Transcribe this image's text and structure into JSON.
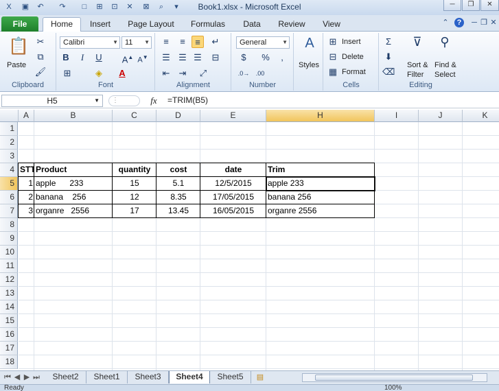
{
  "window": {
    "title": "Book1.xlsx  -  Microsoft Excel"
  },
  "ribbon_tabs": [
    "File",
    "Home",
    "Insert",
    "Page Layout",
    "Formulas",
    "Data",
    "Review",
    "View"
  ],
  "active_tab": "Home",
  "ribbon": {
    "clipboard": {
      "label": "Clipboard",
      "paste": "Paste"
    },
    "font": {
      "label": "Font",
      "font_name": "Calibri",
      "font_size": "11"
    },
    "alignment": {
      "label": "Alignment"
    },
    "number": {
      "label": "Number",
      "format": "General"
    },
    "styles": {
      "label": "Styles"
    },
    "cells": {
      "label": "Cells",
      "insert": "Insert",
      "delete": "Delete",
      "format": "Format"
    },
    "editing": {
      "label": "Editing",
      "sort_1": "Sort &",
      "sort_2": "Filter",
      "find_1": "Find &",
      "find_2": "Select"
    }
  },
  "formula_bar": {
    "name_box": "H5",
    "fx": "fx",
    "formula": "=TRIM(B5)"
  },
  "columns": [
    "A",
    "B",
    "C",
    "D",
    "E",
    "H",
    "I",
    "J",
    "K"
  ],
  "rows": [
    "1",
    "2",
    "3",
    "4",
    "5",
    "6",
    "7",
    "8",
    "9",
    "10",
    "11",
    "12",
    "13",
    "14",
    "15",
    "16",
    "17",
    "18"
  ],
  "table": {
    "headers": [
      "STT",
      "Product",
      "quantity",
      "cost",
      "date",
      "Trim"
    ],
    "rows": [
      [
        "1",
        "apple      233",
        "15",
        "5.1",
        "12/5/2015",
        "apple 233"
      ],
      [
        "2",
        "banana    256",
        "12",
        "8.35",
        "17/05/2015",
        "banana 256"
      ],
      [
        "3",
        "organre   2556",
        "17",
        "13.45",
        "16/05/2015",
        "organre 2556"
      ]
    ]
  },
  "sheets": [
    "Sheet2",
    "Sheet1",
    "Sheet3",
    "Sheet4",
    "Sheet5"
  ],
  "active_sheet": "Sheet4",
  "status": {
    "text": "Ready",
    "zoom": "100%"
  }
}
